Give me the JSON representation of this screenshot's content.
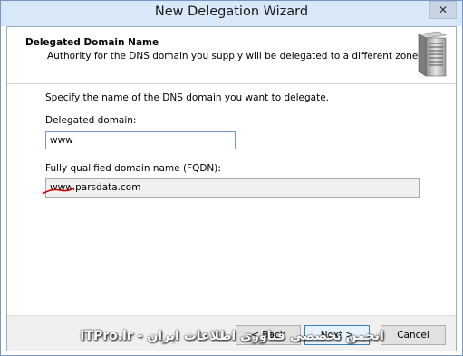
{
  "window": {
    "title": "New Delegation Wizard",
    "close_glyph": "✕"
  },
  "header": {
    "title": "Delegated Domain Name",
    "subtitle": "Authority for the DNS domain you supply will be delegated to a different zone.",
    "icon": "server-icon"
  },
  "main": {
    "instruction": "Specify the name of the DNS domain you want to delegate.",
    "delegated_domain": {
      "label": "Delegated domain:",
      "value": "www"
    },
    "fqdn": {
      "label": "Fully qualified domain name (FQDN):",
      "value": "www.parsdata.com"
    }
  },
  "buttons": {
    "back": "< Back",
    "next": "Next >",
    "cancel": "Cancel"
  },
  "watermark": {
    "text": "انجمن تخصصی فناوری اطلاعات ایران - ITPro.ir"
  },
  "colors": {
    "title_bar": "#d9e8f8",
    "annotation": "#cc0000"
  }
}
